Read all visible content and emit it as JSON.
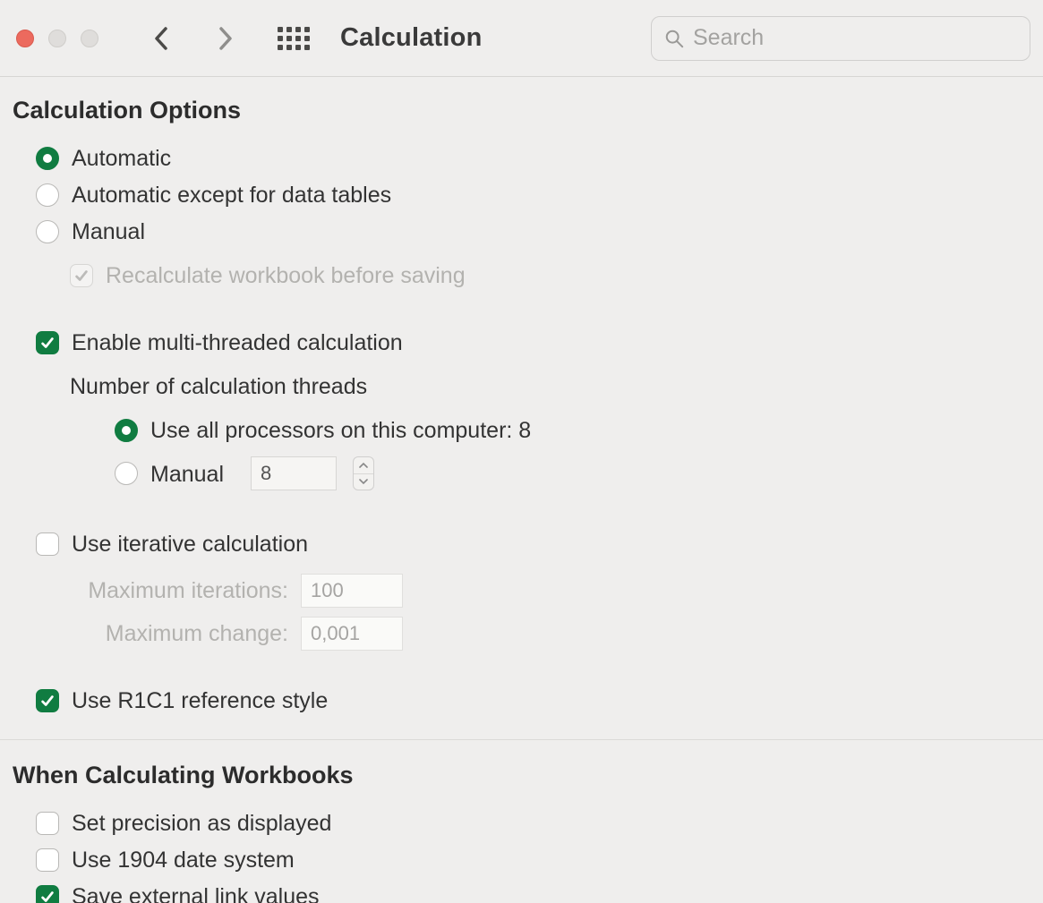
{
  "toolbar": {
    "title": "Calculation",
    "search_placeholder": "Search"
  },
  "sections": {
    "calc_options": {
      "title": "Calculation Options",
      "mode": {
        "automatic": "Automatic",
        "automatic_except": "Automatic except for data tables",
        "manual": "Manual",
        "selected": "automatic"
      },
      "recalc_before_save": {
        "label": "Recalculate workbook before saving",
        "checked": true,
        "enabled": false
      },
      "multithread": {
        "label": "Enable multi-threaded calculation",
        "checked": true,
        "threads_label": "Number of calculation threads",
        "use_all_label": "Use all processors on this computer: 8",
        "manual_label": "Manual",
        "manual_value": "8",
        "selected": "all"
      },
      "iterative": {
        "label": "Use iterative calculation",
        "checked": false,
        "max_iter_label": "Maximum iterations:",
        "max_iter_value": "100",
        "max_change_label": "Maximum change:",
        "max_change_value": "0,001"
      },
      "r1c1": {
        "label": "Use R1C1 reference style",
        "checked": true
      }
    },
    "when_calculating": {
      "title": "When Calculating Workbooks",
      "precision": {
        "label": "Set precision as displayed",
        "checked": false
      },
      "date1904": {
        "label": "Use 1904 date system",
        "checked": false
      },
      "save_external": {
        "label": "Save external link values",
        "checked": true
      }
    }
  }
}
